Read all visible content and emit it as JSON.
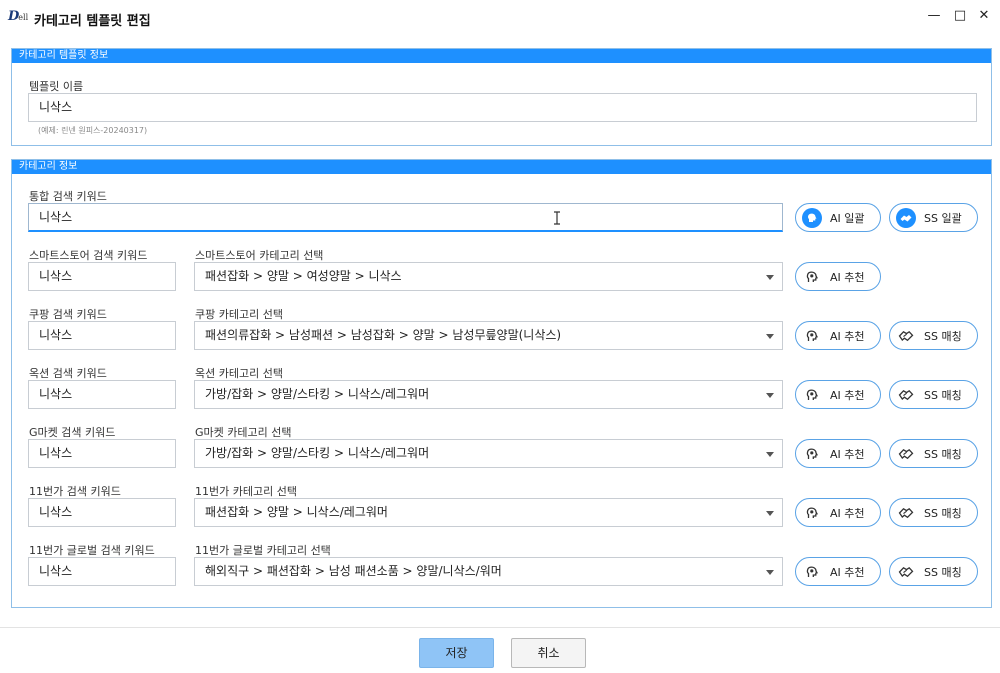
{
  "window": {
    "logo_main": "D",
    "logo_sub": "ell",
    "title": "카테고리 템플릿 편집",
    "minimize": "—",
    "maximize": "□",
    "close": "✕"
  },
  "template_info": {
    "header": "카테고리 템플릿 정보",
    "name_label": "템플릿 이름",
    "name_value": "니삭스",
    "name_hint": "(예제: 린넨 원피스-20240317)"
  },
  "category_info": {
    "header": "카테고리 정보",
    "unified_label": "통합 검색 키워드",
    "unified_value": "니삭스",
    "ai_bulk_label": "AI 일괄",
    "ss_bulk_label": "SS 일괄",
    "rows": [
      {
        "keyword_label": "스마트스토어 검색 키워드",
        "keyword_value": "니삭스",
        "category_label": "스마트스토어 카테고리 선택",
        "category_value": "패션잡화 > 양말 > 여성양말 > 니삭스",
        "ai_label": "AI 추천",
        "ss_label": ""
      },
      {
        "keyword_label": "쿠팡 검색 키워드",
        "keyword_value": "니삭스",
        "category_label": "쿠팡 카테고리 선택",
        "category_value": "패션의류잡화 > 남성패션 > 남성잡화 > 양말 > 남성무릎양말(니삭스)",
        "ai_label": "AI 추천",
        "ss_label": "SS 매칭"
      },
      {
        "keyword_label": "옥션 검색 키워드",
        "keyword_value": "니삭스",
        "category_label": "옥션 카테고리 선택",
        "category_value": "가방/잡화 > 양말/스타킹 > 니삭스/레그워머",
        "ai_label": "AI 추천",
        "ss_label": "SS 매칭"
      },
      {
        "keyword_label": "G마켓 검색 키워드",
        "keyword_value": "니삭스",
        "category_label": "G마켓 카테고리 선택",
        "category_value": "가방/잡화 > 양말/스타킹 > 니삭스/레그워머",
        "ai_label": "AI 추천",
        "ss_label": "SS 매칭"
      },
      {
        "keyword_label": "11번가 검색 키워드",
        "keyword_value": "니삭스",
        "category_label": "11번가 카테고리 선택",
        "category_value": "패션잡화 > 양말 > 니삭스/레그워머",
        "ai_label": "AI 추천",
        "ss_label": "SS 매칭"
      },
      {
        "keyword_label": "11번가 글로벌 검색 키워드",
        "keyword_value": "니삭스",
        "category_label": "11번가 글로벌 카테고리 선택",
        "category_value": "해외직구 > 패션잡화 > 남성 패션소품 > 양말/니삭스/워머",
        "ai_label": "AI 추천",
        "ss_label": "SS 매칭"
      }
    ]
  },
  "footer": {
    "save_label": "저장",
    "cancel_label": "취소"
  },
  "colors": {
    "accent": "#1e90ff",
    "section_border": "#8fbfe8",
    "primary_button": "#8fc4f6"
  }
}
